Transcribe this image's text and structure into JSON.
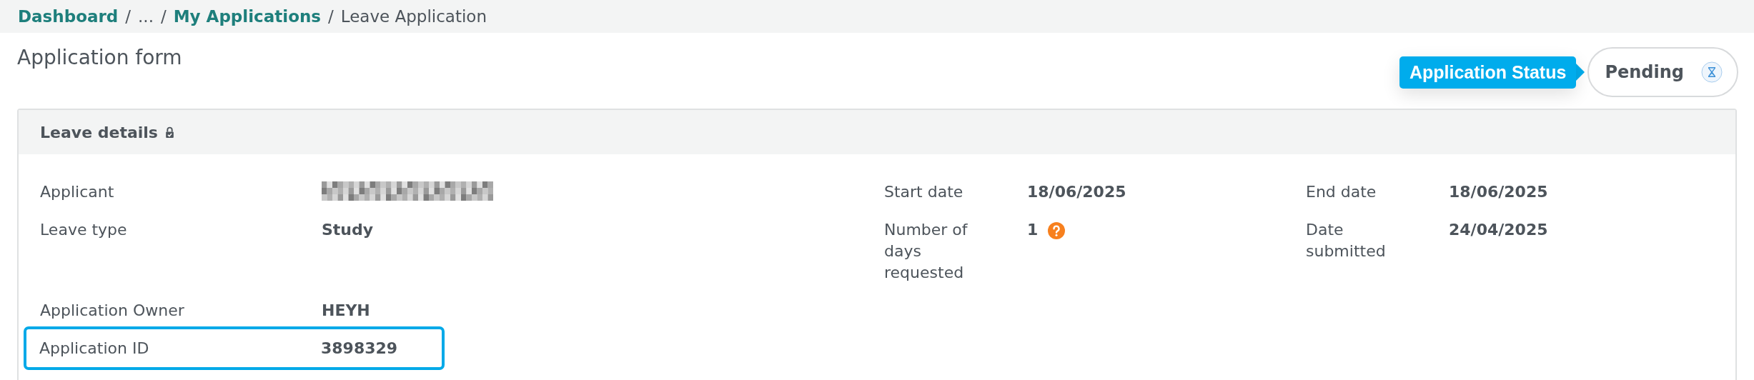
{
  "breadcrumb": [
    {
      "kind": "link",
      "label": "Dashboard"
    },
    {
      "kind": "separator",
      "label": "/"
    },
    {
      "kind": "text",
      "label": "..."
    },
    {
      "kind": "separator",
      "label": "/"
    },
    {
      "kind": "link",
      "label": "My Applications"
    },
    {
      "kind": "separator",
      "label": "/"
    },
    {
      "kind": "text",
      "label": "Leave Application"
    }
  ],
  "page_title": "Application form",
  "status": {
    "label": "Application Status",
    "value": "Pending"
  },
  "card": {
    "title": "Leave details",
    "locked": true,
    "rows": [
      {
        "highlighted": false,
        "fields": [
          {
            "label": "Applicant",
            "value_redacted": true
          },
          {
            "label": "Start date",
            "value": "18/06/2025"
          },
          {
            "label": "End date",
            "value": "18/06/2025"
          }
        ]
      },
      {
        "highlighted": false,
        "fields": [
          {
            "label": "Leave type",
            "value": "Study"
          },
          {
            "label": "Number of days requested",
            "value": "1",
            "help": true
          },
          {
            "label": "Date submitted",
            "value": "24/04/2025"
          }
        ]
      },
      {
        "highlighted": false,
        "fields": [
          {
            "label": "Application Owner",
            "value": "HEYH"
          }
        ]
      },
      {
        "highlighted": true,
        "fields": [
          {
            "label": "Application ID",
            "value": "3898329"
          }
        ]
      }
    ]
  }
}
